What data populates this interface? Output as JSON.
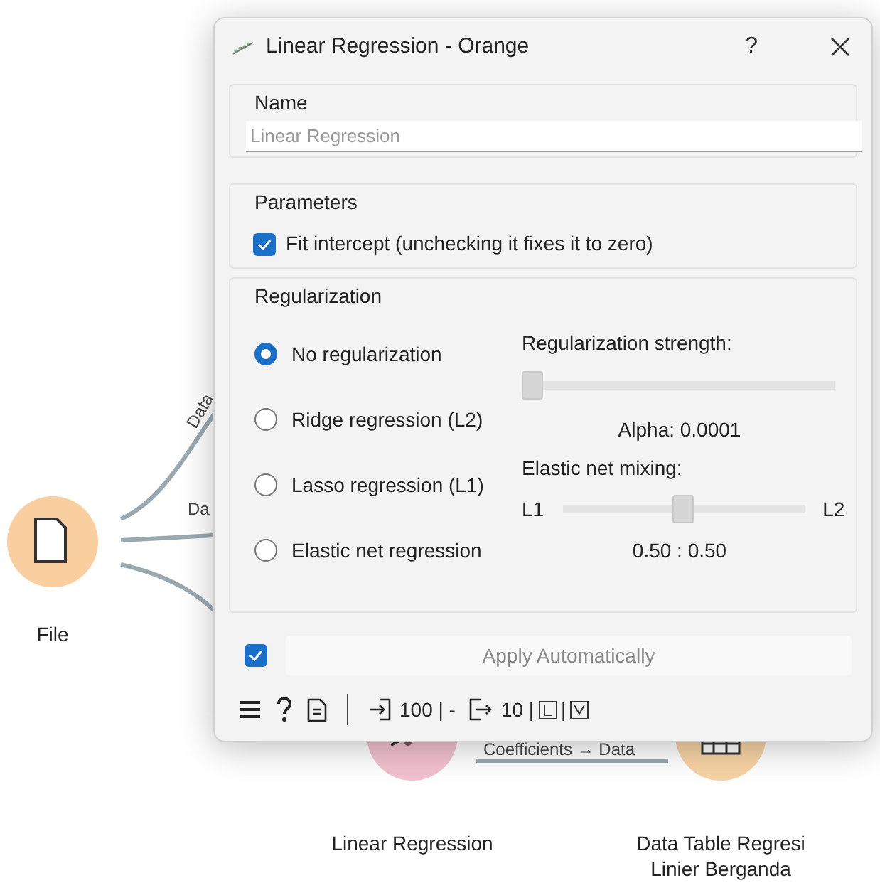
{
  "canvas": {
    "nodes": [
      {
        "kind": "file",
        "color": "#f9cf9f",
        "label": "File"
      },
      {
        "kind": "regression",
        "color": "#f2c1cf",
        "label": "Linear Regression"
      },
      {
        "kind": "table",
        "color": "#f6d3a4",
        "label": "Data Table Regresi",
        "label_2": "Linier Berganda"
      }
    ],
    "links": [
      {
        "label": "Data"
      },
      {
        "label": "Da"
      },
      {
        "label": "Coefficients → Data"
      }
    ]
  },
  "window": {
    "title": "Linear Regression - Orange",
    "help": "?"
  },
  "name_group": {
    "label": "Name",
    "placeholder": "Linear Regression"
  },
  "parameters": {
    "label": "Parameters",
    "fit_intercept": {
      "label": "Fit intercept (unchecking it fixes it to zero)",
      "checked": true
    }
  },
  "regularization": {
    "label": "Regularization",
    "options": [
      {
        "label": "No regularization",
        "selected": true
      },
      {
        "label": "Ridge regression (L2)",
        "selected": false
      },
      {
        "label": "Lasso regression (L1)",
        "selected": false
      },
      {
        "label": "Elastic net regression",
        "selected": false
      }
    ],
    "strength": {
      "label": "Regularization strength:",
      "level": 0,
      "reading": "Alpha: 0.0001"
    },
    "mixing": {
      "label": "Elastic net mixing:",
      "min_label": "L1",
      "max_label": "L2",
      "level": 0.5,
      "reading": "0.50 : 0.50"
    }
  },
  "apply": {
    "checked": true,
    "label": "Apply Automatically"
  },
  "status_bar": {
    "input_summary": "100 | -",
    "output_summary": "10 |",
    "separator": "|"
  }
}
